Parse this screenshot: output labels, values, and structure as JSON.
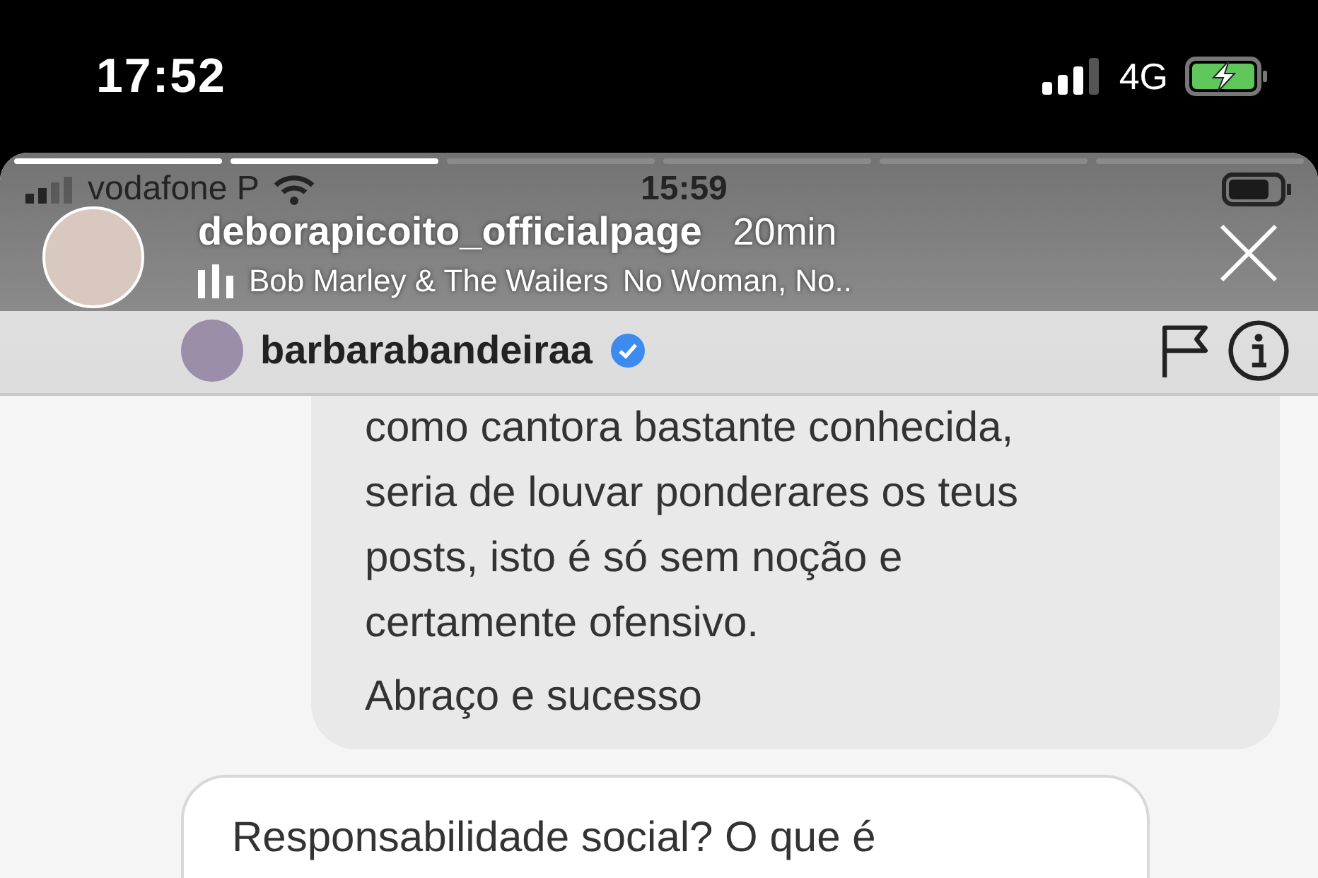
{
  "phone_status_bar": {
    "time": "17:52",
    "network": "4G",
    "charging": true
  },
  "story": {
    "progress": [
      {
        "viewed": true
      },
      {
        "viewed": true
      },
      {
        "viewed": false
      },
      {
        "viewed": false
      },
      {
        "viewed": false
      },
      {
        "viewed": false
      }
    ],
    "username": "deborapicoito_officialpage",
    "time": "20min",
    "music_artist": "Bob Marley & The Wailers",
    "music_song": "No Woman, No.."
  },
  "screenshot": {
    "status_bar": {
      "carrier": "vodafone P",
      "time": "15:59"
    },
    "chat_header": {
      "username": "barbarabandeiraa",
      "verified": true
    },
    "messages": [
      {
        "kind": "received",
        "paragraphs": [
          [
            "como cantora bastante conhecida,",
            "seria de louvar ponderares os teus",
            "posts, isto é só sem noção e",
            "certamente ofensivo."
          ],
          [
            "Abraço e sucesso"
          ]
        ]
      },
      {
        "kind": "sent",
        "paragraphs": [
          [
            "Responsabilidade social? O que é"
          ]
        ]
      }
    ]
  }
}
